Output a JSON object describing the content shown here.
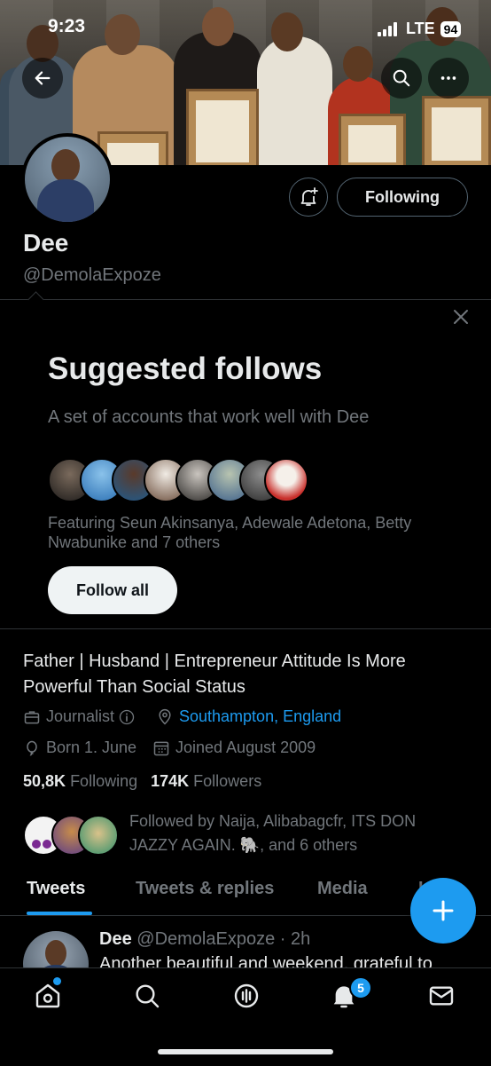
{
  "status_bar": {
    "time": "9:23",
    "network": "LTE",
    "battery": "94"
  },
  "profile": {
    "name": "Dee",
    "handle": "@DemolaExpoze",
    "following_button": "Following",
    "bio": "Father | Husband | Entrepreneur Attitude Is More Powerful Than Social Status",
    "profession": "Journalist",
    "location": "Southampton, England",
    "born": "Born 1. June",
    "joined": "Joined August 2009",
    "following_count": "50,8K",
    "following_label": "Following",
    "followers_count": "174K",
    "followers_label": "Followers",
    "followed_by": "Followed by Naija, Alibabagcfr, ITS DON JAZZY AGAIN. 🐘, and 6 others"
  },
  "suggested": {
    "title": "Suggested follows",
    "subtitle": "A set of accounts that work well with Dee",
    "featuring": "Featuring Seun Akinsanya, Adewale Adetona, Betty Nwabunike and 7 others",
    "follow_all": "Follow all"
  },
  "tabs": [
    {
      "label": "Tweets",
      "active": true
    },
    {
      "label": "Tweets & replies",
      "active": false
    },
    {
      "label": "Media",
      "active": false
    },
    {
      "label": "Likes",
      "active": false
    }
  ],
  "tweet": {
    "name": "Dee",
    "handle_time": "@DemolaExpoze · 2h",
    "text": "Another beautiful and weekend, grateful to"
  },
  "bottom_nav": {
    "notifications_badge": "5"
  },
  "colors": {
    "accent": "#1d9bf0",
    "background": "#000000",
    "muted": "#71767b"
  }
}
